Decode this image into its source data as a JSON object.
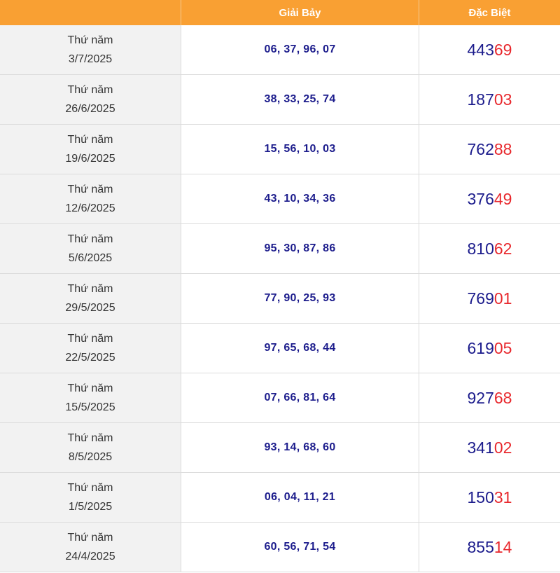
{
  "table": {
    "headers": {
      "date": "",
      "prize7": "Giải Bảy",
      "special": "Đặc Biệt"
    },
    "colors": {
      "header_bg": "#f9a033",
      "number_blue": "#1c1c8c",
      "tail_red": "#e8282d"
    },
    "rows": [
      {
        "weekday": "Thứ năm",
        "date": "3/7/2025",
        "prize7": "06, 37, 96, 07",
        "special_head": "443",
        "special_tail": "69"
      },
      {
        "weekday": "Thứ năm",
        "date": "26/6/2025",
        "prize7": "38, 33, 25, 74",
        "special_head": "187",
        "special_tail": "03"
      },
      {
        "weekday": "Thứ năm",
        "date": "19/6/2025",
        "prize7": "15, 56, 10, 03",
        "special_head": "762",
        "special_tail": "88"
      },
      {
        "weekday": "Thứ năm",
        "date": "12/6/2025",
        "prize7": "43, 10, 34, 36",
        "special_head": "376",
        "special_tail": "49"
      },
      {
        "weekday": "Thứ năm",
        "date": "5/6/2025",
        "prize7": "95, 30, 87, 86",
        "special_head": "810",
        "special_tail": "62"
      },
      {
        "weekday": "Thứ năm",
        "date": "29/5/2025",
        "prize7": "77, 90, 25, 93",
        "special_head": "769",
        "special_tail": "01"
      },
      {
        "weekday": "Thứ năm",
        "date": "22/5/2025",
        "prize7": "97, 65, 68, 44",
        "special_head": "619",
        "special_tail": "05"
      },
      {
        "weekday": "Thứ năm",
        "date": "15/5/2025",
        "prize7": "07, 66, 81, 64",
        "special_head": "927",
        "special_tail": "68"
      },
      {
        "weekday": "Thứ năm",
        "date": "8/5/2025",
        "prize7": "93, 14, 68, 60",
        "special_head": "341",
        "special_tail": "02"
      },
      {
        "weekday": "Thứ năm",
        "date": "1/5/2025",
        "prize7": "06, 04, 11, 21",
        "special_head": "150",
        "special_tail": "31"
      },
      {
        "weekday": "Thứ năm",
        "date": "24/4/2025",
        "prize7": "60, 56, 71, 54",
        "special_head": "855",
        "special_tail": "14"
      }
    ]
  }
}
